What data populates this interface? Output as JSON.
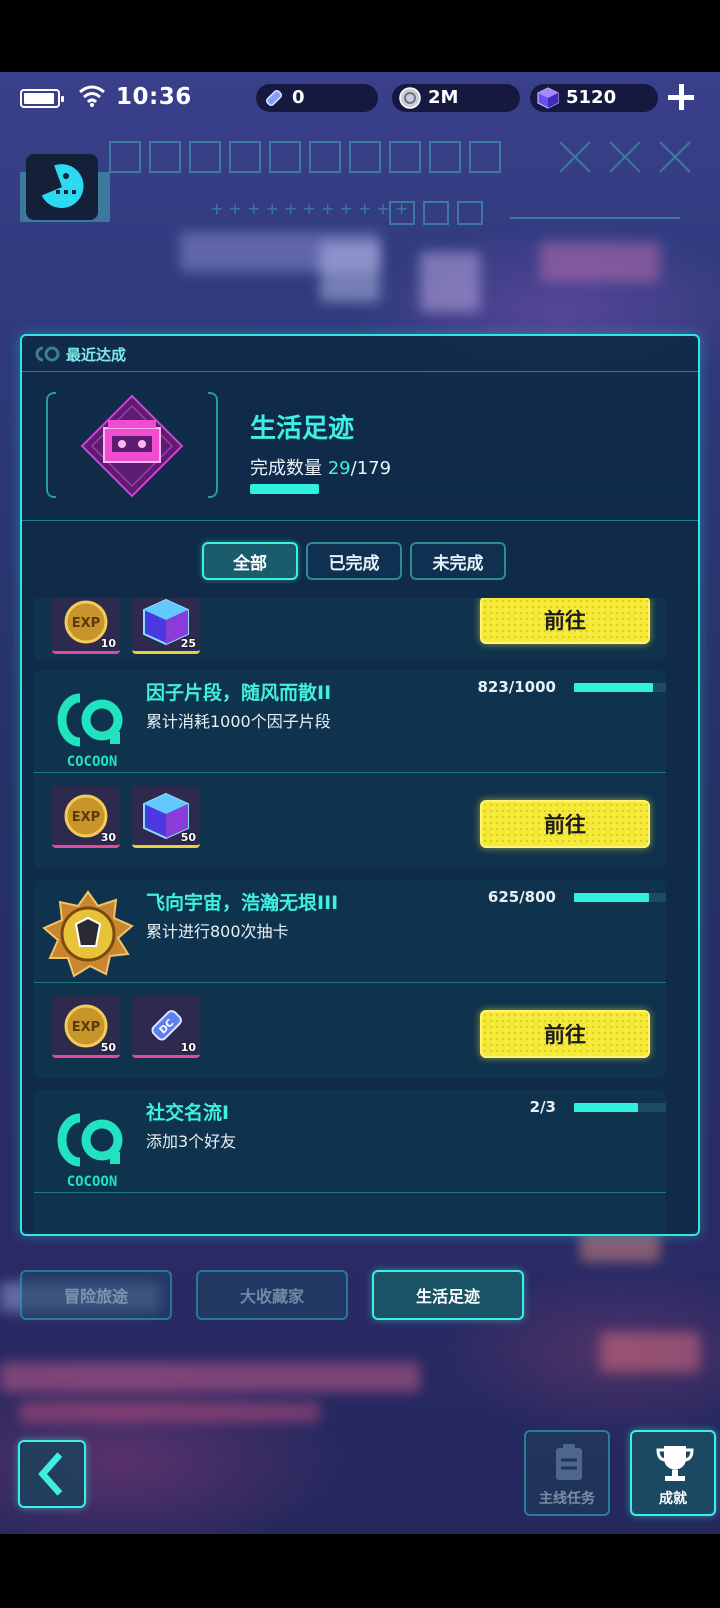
{
  "status_bar": {
    "time": "10:36",
    "battery_level": 0.8
  },
  "currencies": [
    {
      "name": "ticket-icon",
      "value": "0"
    },
    {
      "name": "coin-icon",
      "value": "2M"
    },
    {
      "name": "gem-cube-icon",
      "value": "5120"
    }
  ],
  "recent": {
    "label": "最近达成",
    "title": "生活足迹",
    "count_label": "完成数量",
    "done": "29",
    "total": "/179",
    "progress": 0.162
  },
  "filters": [
    {
      "label": "全部",
      "active": true
    },
    {
      "label": "已完成",
      "active": false
    },
    {
      "label": "未完成",
      "active": false
    }
  ],
  "cards": [
    {
      "rewards": [
        {
          "icon": "exp-coin-icon",
          "qty": "10"
        },
        {
          "icon": "gem-cube-icon",
          "qty": "25"
        }
      ],
      "go_label": "前往"
    },
    {
      "icon": "cocoon-logo-icon",
      "logo_text": "COCOON",
      "name": "因子片段，随风而散II",
      "desc": "累计消耗1000个因子片段",
      "progress_text": "823/1000",
      "progress": 0.823,
      "rewards": [
        {
          "icon": "exp-coin-icon",
          "qty": "30"
        },
        {
          "icon": "gem-cube-icon",
          "qty": "50"
        }
      ],
      "go_label": "前往"
    },
    {
      "icon": "gold-medal-icon",
      "name": "飞向宇宙，浩瀚无垠III",
      "desc": "累计进行800次抽卡",
      "progress_text": "625/800",
      "progress": 0.78,
      "rewards": [
        {
          "icon": "exp-coin-icon",
          "qty": "50"
        },
        {
          "icon": "ticket-icon",
          "qty": "10"
        }
      ],
      "go_label": "前往"
    },
    {
      "icon": "cocoon-logo-icon",
      "logo_text": "COCOON",
      "name": "社交名流I",
      "desc": "添加3个好友",
      "progress_text": "2/3",
      "progress": 0.667
    }
  ],
  "category_tabs": [
    {
      "label": "冒险旅途",
      "active": false
    },
    {
      "label": "大收藏家",
      "active": false
    },
    {
      "label": "生活足迹",
      "active": true
    }
  ],
  "bottom_nav": [
    {
      "label": "主线任务",
      "icon": "clipboard-icon",
      "active": false
    },
    {
      "label": "成就",
      "icon": "trophy-icon",
      "active": true
    }
  ],
  "colors": {
    "accent": "#3ff0e2",
    "button_yellow": "#f5e93a",
    "panel": "#0e2a46"
  }
}
